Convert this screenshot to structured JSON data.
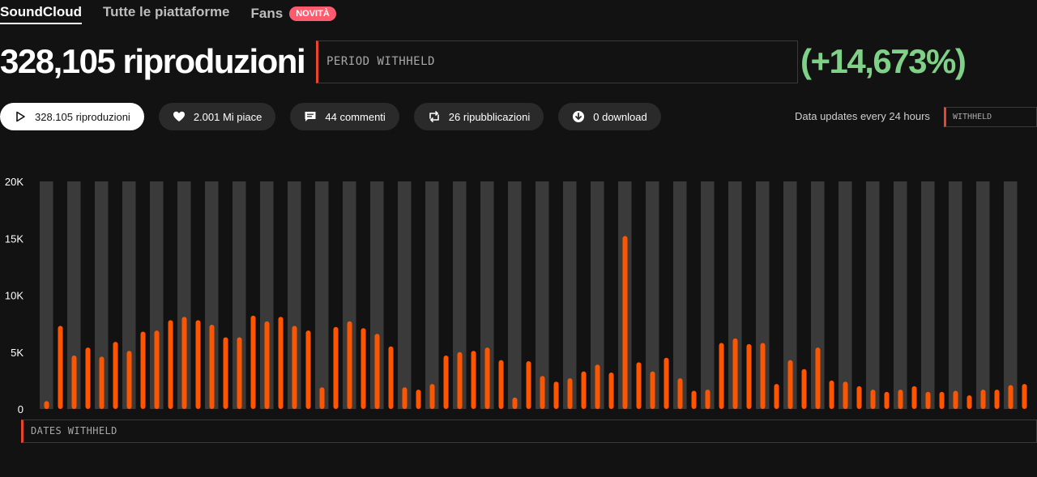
{
  "tabs": [
    {
      "label": "SoundCloud",
      "active": true
    },
    {
      "label": "Tutte le piattaforme",
      "active": false
    },
    {
      "label": "Fans",
      "active": false,
      "badge": "NOVITÀ"
    }
  ],
  "headline": {
    "total": "328,105 riproduzioni",
    "period_placeholder": "PERIOD WITHHELD",
    "change": "(+14,673%)"
  },
  "stats": [
    {
      "icon": "play-icon",
      "label": "328.105 riproduzioni",
      "active": true
    },
    {
      "icon": "heart-icon",
      "label": "2.001 Mi piace",
      "active": false
    },
    {
      "icon": "comment-icon",
      "label": "44 commenti",
      "active": false
    },
    {
      "icon": "repost-icon",
      "label": "26 ripubblicazioni",
      "active": false
    },
    {
      "icon": "download-icon",
      "label": "0 download",
      "active": false
    }
  ],
  "updates_note": "Data updates every 24 hours",
  "updates_withheld": "WITHHELD",
  "dates_placeholder": "DATES WITHHELD",
  "colors": {
    "bar": "#ff5500",
    "band": "#3a3a3a",
    "positive": "#7fd187",
    "accent_border": "#e8442f",
    "badge": "#ff5b6e"
  },
  "chart_data": {
    "type": "bar",
    "ylim": [
      0,
      20000
    ],
    "yticks": [
      {
        "value": 20000,
        "label": "20K"
      },
      {
        "value": 15000,
        "label": "15K"
      },
      {
        "value": 10000,
        "label": "10K"
      },
      {
        "value": 5000,
        "label": "5K"
      },
      {
        "value": 0,
        "label": "0"
      }
    ],
    "values": [
      700,
      7300,
      4700,
      5400,
      4600,
      5900,
      5100,
      6800,
      6900,
      7800,
      8100,
      7800,
      7400,
      6300,
      6300,
      8200,
      7700,
      8100,
      7300,
      6900,
      1900,
      7200,
      7700,
      7100,
      6600,
      5500,
      1900,
      1700,
      2200,
      4700,
      5000,
      5100,
      5400,
      4300,
      1000,
      4200,
      2900,
      2400,
      2700,
      3300,
      3900,
      3200,
      15200,
      4100,
      3300,
      4500,
      2700,
      1600,
      1700,
      5800,
      6200,
      5700,
      5800,
      2200,
      4300,
      3500,
      5400,
      2500,
      2400,
      2000,
      1700,
      1500,
      1700,
      2000,
      1500,
      1500,
      1600,
      1200,
      1700,
      1700,
      2100,
      2200
    ]
  }
}
